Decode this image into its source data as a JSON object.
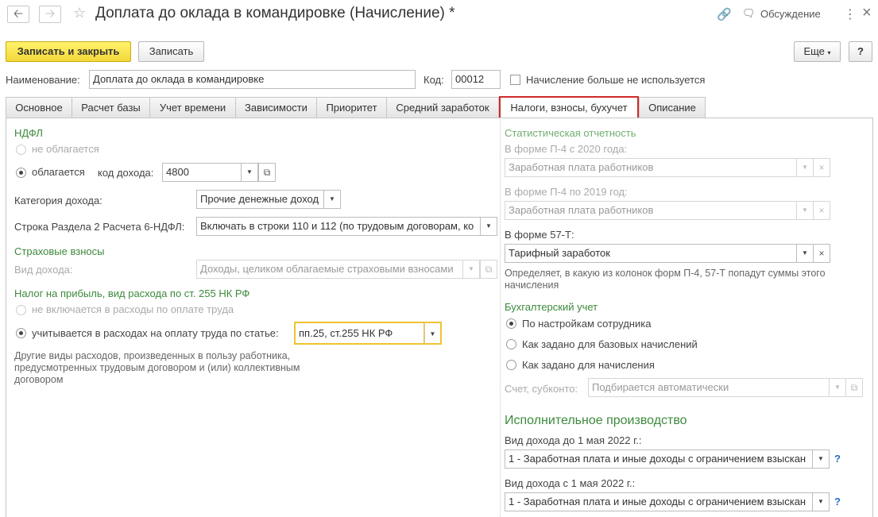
{
  "window": {
    "title": "Доплата до оклада в командировке (Начисление) *",
    "discussion_label": "Обсуждение",
    "more_icon": "⋮",
    "close_icon": "×"
  },
  "toolbar": {
    "save_close_label": "Записать и закрыть",
    "save_label": "Записать",
    "more_label": "Еще",
    "help_label": "?"
  },
  "header": {
    "name_label": "Наименование:",
    "name_value": "Доплата до оклада в командировке",
    "code_label": "Код:",
    "code_value": "00012",
    "not_used_label": "Начисление больше не используется"
  },
  "tabs": [
    {
      "label": "Основное"
    },
    {
      "label": "Расчет базы"
    },
    {
      "label": "Учет времени"
    },
    {
      "label": "Зависимости"
    },
    {
      "label": "Приоритет"
    },
    {
      "label": "Средний заработок"
    },
    {
      "label": "Налоги, взносы, бухучет"
    },
    {
      "label": "Описание"
    }
  ],
  "left": {
    "ndfl_title": "НДФЛ",
    "not_taxed_label": "не облагается",
    "taxed_label": "облагается",
    "income_code_label": "код дохода:",
    "income_code_value": "4800",
    "income_category_label": "Категория дохода:",
    "income_category_value": "Прочие денежные доход",
    "line_6ndfl_label": "Строка Раздела 2 Расчета 6-НДФЛ:",
    "line_6ndfl_value": "Включать в строки 110 и 112 (по трудовым договорам, ко",
    "insurance_title": "Страховые взносы",
    "income_type_label": "Вид дохода:",
    "income_type_value": "Доходы, целиком облагаемые страховыми взносами",
    "profit_tax_title": "Налог на прибыль, вид расхода по ст. 255 НК РФ",
    "not_included_label": "не включается в расходы по оплате труда",
    "included_label": "учитывается в расходах на оплату труда по статье:",
    "article_value": "пп.25, ст.255 НК РФ",
    "article_note": "Другие виды расходов, произведенных в пользу работника, предусмотренных трудовым договором и (или) коллективным договором"
  },
  "right": {
    "stat_title": "Статистическая отчетность",
    "p4_2020_label": "В форме П-4 с 2020 года:",
    "p4_2020_value": "Заработная плата работников",
    "p4_2019_label": "В форме П-4 по 2019 год:",
    "p4_2019_value": "Заработная плата работников",
    "f57_label": "В форме 57-Т:",
    "f57_value": "Тарифный заработок",
    "stat_note": "Определяет, в какую из колонок форм П-4, 57-Т попадут суммы этого начисления",
    "accounting_title": "Бухгалтерский учет",
    "acc_opt1": "По настройкам сотрудника",
    "acc_opt2": "Как задано для базовых начислений",
    "acc_opt3": "Как задано для начисления",
    "account_label": "Счет, субконто:",
    "account_value": "Подбирается автоматически",
    "enforcement_title": "Исполнительное производство",
    "before_label": "Вид дохода до 1 мая 2022 г.:",
    "before_value": "1 - Заработная плата и иные доходы с ограничением взыскан",
    "after_label": "Вид дохода с 1 мая 2022 г.:",
    "after_value": "1 - Заработная плата и иные доходы с ограничением взыскан",
    "help_mark": "?"
  },
  "icons": {
    "back": "back-arrow-icon",
    "forward": "forward-arrow-icon",
    "star": "star-icon",
    "link": "link-icon",
    "discussion": "chat-icon"
  },
  "colors": {
    "primary_button": "#f4d73a",
    "active_tab_border": "#d12a2a",
    "section_title": "#3c8a3c",
    "highlight_field": "#f1c232",
    "help_link": "#2a6fc6"
  }
}
